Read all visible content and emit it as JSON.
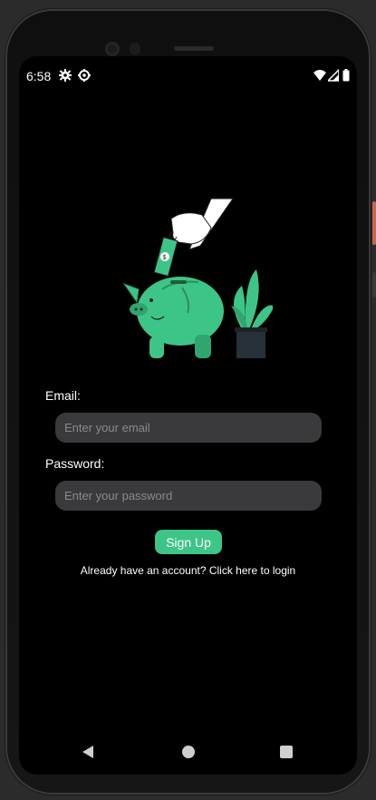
{
  "status_bar": {
    "time": "6:58",
    "left_icons": [
      "gear-icon",
      "settings-alt-icon"
    ],
    "right_icons": [
      "wifi-icon",
      "signal-icon",
      "battery-icon"
    ]
  },
  "form": {
    "email_label": "Email:",
    "email_placeholder": "Enter your email",
    "password_label": "Password:",
    "password_placeholder": "Enter your password",
    "signup_label": "Sign Up",
    "login_link": "Already have an account? Click here to login"
  },
  "nav_bar": {
    "icons": [
      "back-icon",
      "home-icon",
      "recents-icon"
    ]
  },
  "colors": {
    "accent": "#3dc587",
    "background": "#000000",
    "input_bg": "#3a3a3d",
    "plant_pot": "#263238"
  }
}
